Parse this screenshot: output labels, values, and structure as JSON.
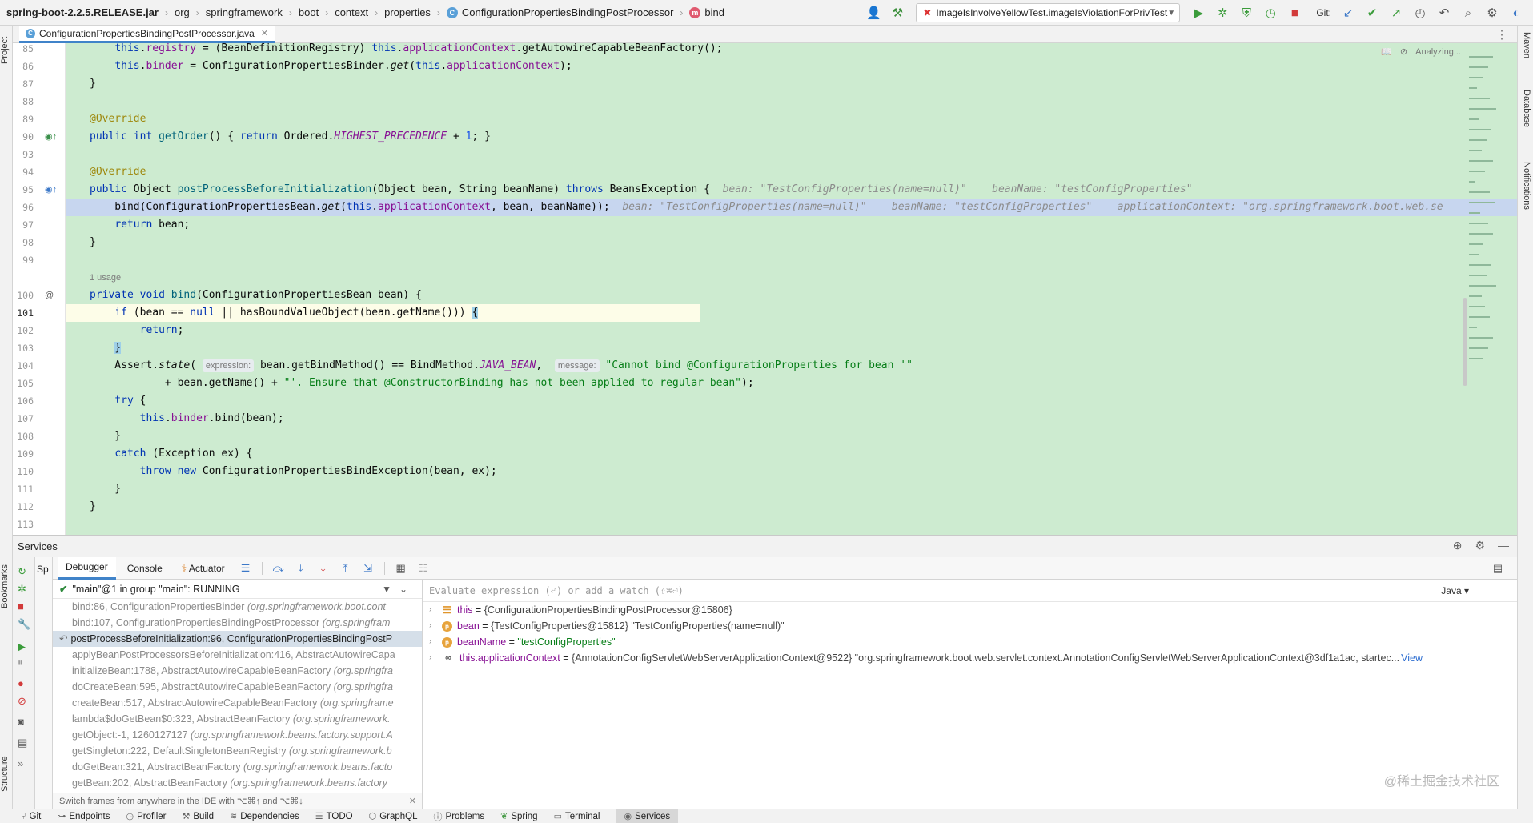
{
  "breadcrumbs": [
    "spring-boot-2.2.5.RELEASE.jar",
    "org",
    "springframework",
    "boot",
    "context",
    "properties",
    "ConfigurationPropertiesBindingPostProcessor",
    "bind"
  ],
  "run_config": "ImageIsInvolveYellowTest.imageIsViolationForPrivTest",
  "git_label": "Git:",
  "editor_tab": "ConfigurationPropertiesBindingPostProcessor.java",
  "editor_status": "Analyzing...",
  "left_tabs": [
    "Project",
    "Bookmarks",
    "Structure"
  ],
  "right_tabs": [
    "Maven",
    "Database",
    "Notifications"
  ],
  "gutter": [
    "85",
    "86",
    "87",
    "88",
    "89",
    "90",
    "93",
    "94",
    "95",
    "96",
    "97",
    "98",
    "99",
    "",
    "100",
    "101",
    "102",
    "103",
    "104",
    "105",
    "106",
    "107",
    "108",
    "109",
    "110",
    "111",
    "112",
    "113"
  ],
  "inlay": {
    "l95_bean": "bean: \"TestConfigProperties(name=null)\"",
    "l95_beanName": "beanName: \"testConfigProperties\"",
    "l96_bean": "bean: \"TestConfigProperties(name=null)\"",
    "l96_beanName": "beanName: \"testConfigProperties\"",
    "l96_ctx": "applicationContext: \"org.springframework.boot.web.se",
    "usage": "1 usage",
    "p_expression": "expression:",
    "p_message": "message:"
  },
  "services": {
    "title": "Services",
    "tabs": [
      "Debugger",
      "Console",
      "Actuator"
    ],
    "tree_item": "Sp",
    "thread": "\"main\"@1 in group \"main\": RUNNING",
    "frames": [
      {
        "method": "bind:86, ConfigurationPropertiesBinder",
        "pkg": "(org.springframework.boot.cont"
      },
      {
        "method": "bind:107, ConfigurationPropertiesBindingPostProcessor",
        "pkg": "(org.springfram"
      },
      {
        "method": "postProcessBeforeInitialization:96, ConfigurationPropertiesBindingPostP",
        "pkg": ""
      },
      {
        "method": "applyBeanPostProcessorsBeforeInitialization:416, AbstractAutowireCapa",
        "pkg": ""
      },
      {
        "method": "initializeBean:1788, AbstractAutowireCapableBeanFactory",
        "pkg": "(org.springfra"
      },
      {
        "method": "doCreateBean:595, AbstractAutowireCapableBeanFactory",
        "pkg": "(org.springfra"
      },
      {
        "method": "createBean:517, AbstractAutowireCapableBeanFactory",
        "pkg": "(org.springframe"
      },
      {
        "method": "lambda$doGetBean$0:323, AbstractBeanFactory",
        "pkg": "(org.springframework."
      },
      {
        "method": "getObject:-1, 1260127127",
        "pkg": "(org.springframework.beans.factory.support.A"
      },
      {
        "method": "getSingleton:222, DefaultSingletonBeanRegistry",
        "pkg": "(org.springframework.b"
      },
      {
        "method": "doGetBean:321, AbstractBeanFactory",
        "pkg": "(org.springframework.beans.facto"
      },
      {
        "method": "getBean:202, AbstractBeanFactory",
        "pkg": "(org.springframework.beans.factory"
      }
    ],
    "frames_status": "Switch frames from anywhere in the IDE with ⌥⌘↑ and ⌥⌘↓",
    "eval_placeholder": "Evaluate expression (⏎) or add a watch (⇧⌘⏎)",
    "eval_lang": "Java",
    "variables": [
      {
        "name": "this",
        "eq": " = ",
        "value": "{ConfigurationPropertiesBindingPostProcessor@15806}",
        "str": "",
        "link": ""
      },
      {
        "name": "bean",
        "eq": " = ",
        "value": "{TestConfigProperties@15812} \"TestConfigProperties(name=null)\"",
        "str": "",
        "link": ""
      },
      {
        "name": "beanName",
        "eq": " = ",
        "value": "",
        "str": "\"testConfigProperties\"",
        "link": ""
      },
      {
        "name": "this.applicationContext",
        "eq": " = ",
        "value": "{AnnotationConfigServletWebServerApplicationContext@9522} \"org.springframework.boot.web.servlet.context.AnnotationConfigServletWebServerApplicationContext@3df1a1ac, startec...",
        "str": "",
        "link": "View"
      }
    ],
    "watermark": "@稀土掘金技术社区"
  },
  "statusbar": [
    "Git",
    "Endpoints",
    "Profiler",
    "Build",
    "Dependencies",
    "TODO",
    "GraphQL",
    "Problems",
    "Spring",
    "Terminal",
    "Services"
  ],
  "colors": {
    "editor_bg": "#cdebd0",
    "exec_line": "#c7d6ef",
    "keyword": "#0033b3",
    "field": "#871094",
    "string": "#067d17"
  }
}
